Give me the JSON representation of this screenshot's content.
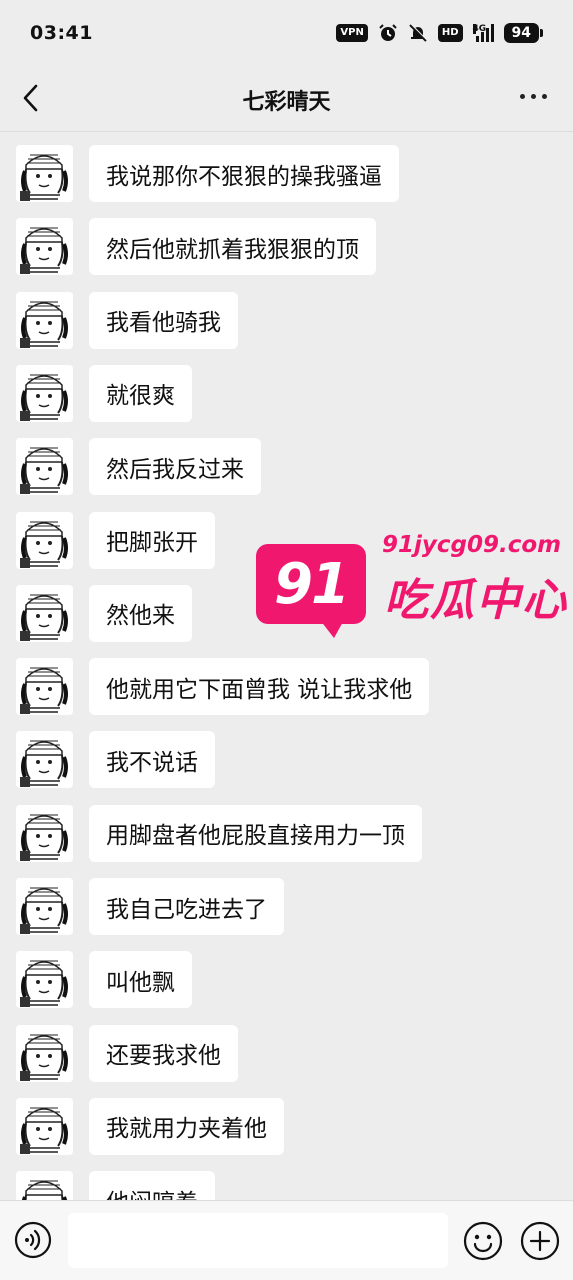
{
  "status": {
    "time": "03:41",
    "vpn": "VPN",
    "hd": "HD",
    "network": "4G",
    "battery": "94"
  },
  "header": {
    "title": "七彩晴天"
  },
  "messages": [
    {
      "text": "我说那你不狠狠的操我骚逼"
    },
    {
      "text": "然后他就抓着我狠狠的顶"
    },
    {
      "text": "我看他骑我"
    },
    {
      "text": "就很爽"
    },
    {
      "text": "然后我反过来"
    },
    {
      "text": "把脚张开"
    },
    {
      "text": "然他来"
    },
    {
      "text": "他就用它下面曾我 说让我求他"
    },
    {
      "text": "我不说话"
    },
    {
      "text": "用脚盘者他屁股直接用力一顶"
    },
    {
      "text": "我自己吃进去了"
    },
    {
      "text": "叫他飘"
    },
    {
      "text": "还要我求他"
    },
    {
      "text": "我就用力夹着他"
    },
    {
      "text": "他闷哼着"
    }
  ],
  "watermark": {
    "number": "91",
    "url": "91jycg09.com",
    "name": "吃瓜中心"
  },
  "input": {
    "value": ""
  },
  "colors": {
    "background": "#ededed",
    "bubble": "#ffffff",
    "watermark": "#f0186e"
  }
}
